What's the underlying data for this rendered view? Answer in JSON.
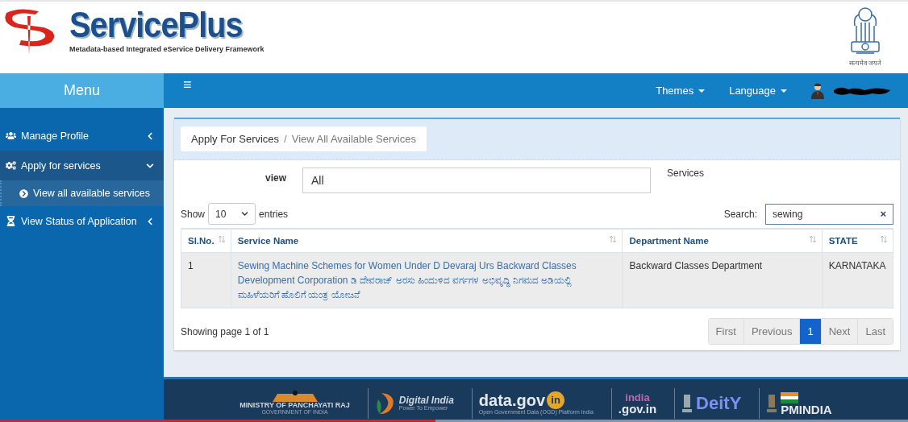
{
  "header": {
    "logo_title": "ServicePlus",
    "logo_subtitle": "Metadata-based Integrated eService Delivery Framework",
    "emblem_motto": "सत्यमेव जयते"
  },
  "navbar": {
    "menu_title": "Menu",
    "menu_toggle": "≡",
    "dropdowns": [
      "Themes",
      "Language"
    ]
  },
  "sidebar": {
    "items": [
      {
        "label": "Manage Profile",
        "expanded": false,
        "selected": false
      },
      {
        "label": "Apply for services",
        "expanded": true,
        "selected": true,
        "children": [
          {
            "label": "View all available services",
            "selected": true
          }
        ]
      },
      {
        "label": "View Status of Application",
        "expanded": false,
        "selected": false
      }
    ]
  },
  "breadcrumb": [
    "Apply For Services",
    "View All Available Services"
  ],
  "breadcrumb_separator": "/",
  "filter": {
    "label": "view",
    "value": "All",
    "note": "Services"
  },
  "table_controls": {
    "show_label": "Show",
    "page_size": "10",
    "entries_label": "entries",
    "search_label": "Search:",
    "search_value": "sewing",
    "clear": "×"
  },
  "table": {
    "columns": [
      "Sl.No.",
      "Service Name",
      "Department Name",
      "STATE"
    ],
    "rows": [
      {
        "sl": "1",
        "service": "Sewing Machine Schemes for Women Under D Devaraj Urs Backward Classes Development Corporation ಡಿ ದೇವರಾಜ್ ಅರಸು ಹಿಂದುಳಿದ ವರ್ಗಗಳ ಅಭಿವೃದ್ಧಿ ನಿಗಮದ ಅಡಿಯಲ್ಲಿ ಮಹಿಳೆಯರಿಗೆ ಹೊಲಿಗೆ ಯಂತ್ರ ಯೋಜನೆ",
        "department": "Backward Classes Department",
        "state": "KARNATAKA"
      }
    ]
  },
  "pagination": {
    "info": "Showing page 1 of 1",
    "buttons": [
      {
        "label": "First",
        "selected": false
      },
      {
        "label": "Previous",
        "selected": false
      },
      {
        "label": "1",
        "selected": true
      },
      {
        "label": "Next",
        "selected": false
      },
      {
        "label": "Last",
        "selected": false
      }
    ]
  },
  "footer": {
    "logos": [
      {
        "kind": "ministry",
        "title": "MINISTRY OF PANCHAYATI RAJ",
        "subtitle": "GOVERNMENT OF INDIA"
      },
      {
        "kind": "digital",
        "title": "Digital India",
        "subtitle": "Power To Empower"
      },
      {
        "kind": "datagov",
        "title": "data.gov",
        "badge": "in",
        "subtitle": "Open Government Data (OGD) Platform India"
      },
      {
        "kind": "indiagov",
        "title": "india",
        "subtitle": ".gov.in"
      },
      {
        "kind": "deity",
        "title": "DeitY"
      },
      {
        "kind": "pmindia",
        "title": "PMINDIA"
      }
    ]
  },
  "video_progress": {
    "level": 0.48
  }
}
